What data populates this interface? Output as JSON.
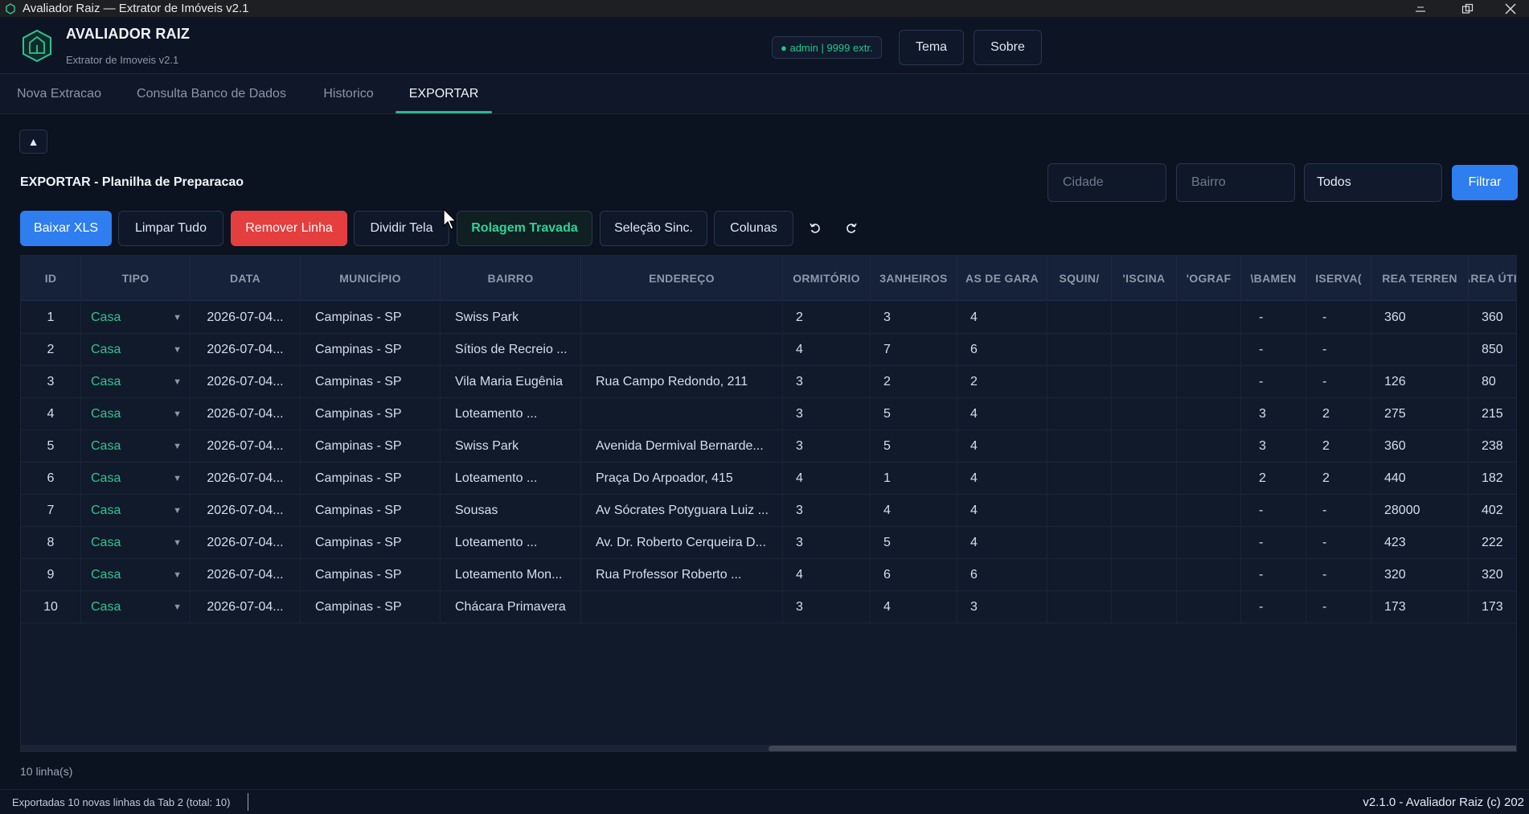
{
  "window": {
    "title": "Avaliador Raiz — Extrator de Imóveis v2.1"
  },
  "header": {
    "app_name": "AVALIADOR RAIZ",
    "app_subtitle": "Extrator de Imoveis v2.1",
    "user_badge": "● admin | 9999 extr.",
    "theme_label": "Tema",
    "about_label": "Sobre"
  },
  "tabs": [
    {
      "label": "Nova Extracao",
      "active": false
    },
    {
      "label": "Consulta Banco de Dados",
      "active": false
    },
    {
      "label": "Historico",
      "active": false
    },
    {
      "label": "EXPORTAR",
      "active": true
    }
  ],
  "main": {
    "collapse_label": "▲",
    "section_title": "EXPORTAR - Planilha de Preparacao",
    "filters": {
      "cidade_placeholder": "Cidade",
      "bairro_placeholder": "Bairro",
      "tipo_value": "Todos",
      "filter_label": "Filtrar"
    },
    "toolbar": {
      "download": "Baixar XLS",
      "clear": "Limpar Tudo",
      "remove_row": "Remover Linha",
      "split": "Dividir Tela",
      "scroll_lock": "Rolagem Travada",
      "sync_select": "Seleção Sinc.",
      "columns": "Colunas"
    },
    "table": {
      "headers": [
        "ID",
        "TIPO",
        "DATA",
        "MUNICÍPIO",
        "BAIRRO",
        "ENDEREÇO",
        "ORMITÓRIO",
        "3ANHEIROS",
        "AS DE GARA",
        "SQUIN/",
        "'ISCINA",
        "'OGRAF",
        "\\BAMEN",
        "ISERVA(",
        "REA TERREN",
        "ÁREA ÚTI"
      ],
      "rows": [
        [
          "1",
          "Casa",
          "2026-07-04...",
          "Campinas - SP",
          "Swiss Park",
          "",
          "2",
          "3",
          "4",
          "",
          "",
          "",
          "-",
          "-",
          "360",
          "360"
        ],
        [
          "2",
          "Casa",
          "2026-07-04...",
          "Campinas - SP",
          "Sítios de Recreio ...",
          "",
          "4",
          "7",
          "6",
          "",
          "",
          "",
          "-",
          "-",
          "",
          "850"
        ],
        [
          "3",
          "Casa",
          "2026-07-04...",
          "Campinas - SP",
          "Vila Maria Eugênia",
          "Rua Campo Redondo, 211",
          "3",
          "2",
          "2",
          "",
          "",
          "",
          "-",
          "-",
          "126",
          "80"
        ],
        [
          "4",
          "Casa",
          "2026-07-04...",
          "Campinas - SP",
          "Loteamento ...",
          "",
          "3",
          "5",
          "4",
          "",
          "",
          "",
          "3",
          "2",
          "275",
          "215"
        ],
        [
          "5",
          "Casa",
          "2026-07-04...",
          "Campinas - SP",
          "Swiss Park",
          "Avenida Dermival Bernarde...",
          "3",
          "5",
          "4",
          "",
          "",
          "",
          "3",
          "2",
          "360",
          "238"
        ],
        [
          "6",
          "Casa",
          "2026-07-04...",
          "Campinas - SP",
          "Loteamento ...",
          "Praça Do Arpoador, 415",
          "4",
          "1",
          "4",
          "",
          "",
          "",
          "2",
          "2",
          "440",
          "182"
        ],
        [
          "7",
          "Casa",
          "2026-07-04...",
          "Campinas - SP",
          "Sousas",
          "Av Sócrates Potyguara Luiz ...",
          "3",
          "4",
          "4",
          "",
          "",
          "",
          "-",
          "-",
          "28000",
          "402"
        ],
        [
          "8",
          "Casa",
          "2026-07-04...",
          "Campinas - SP",
          "Loteamento ...",
          "Av. Dr. Roberto Cerqueira D...",
          "3",
          "5",
          "4",
          "",
          "",
          "",
          "-",
          "-",
          "423",
          "222"
        ],
        [
          "9",
          "Casa",
          "2026-07-04...",
          "Campinas - SP",
          "Loteamento Mon...",
          "Rua Professor Roberto ...",
          "4",
          "6",
          "6",
          "",
          "",
          "",
          "-",
          "-",
          "320",
          "320"
        ],
        [
          "10",
          "Casa",
          "2026-07-04...",
          "Campinas - SP",
          "Chácara Primavera",
          "",
          "3",
          "4",
          "3",
          "",
          "",
          "",
          "-",
          "-",
          "173",
          "173"
        ]
      ]
    },
    "row_count": "10 linha(s)"
  },
  "status": {
    "left": "Exportadas 10 novas linhas da Tab 2 (total: 10)",
    "right": "v2.1.0 - Avaliador Raiz (c) 202"
  },
  "colors": {
    "accent_blue": "#2f7ef0",
    "accent_green": "#2fc38e",
    "danger": "#e53e3e",
    "bg": "#0b1220"
  }
}
